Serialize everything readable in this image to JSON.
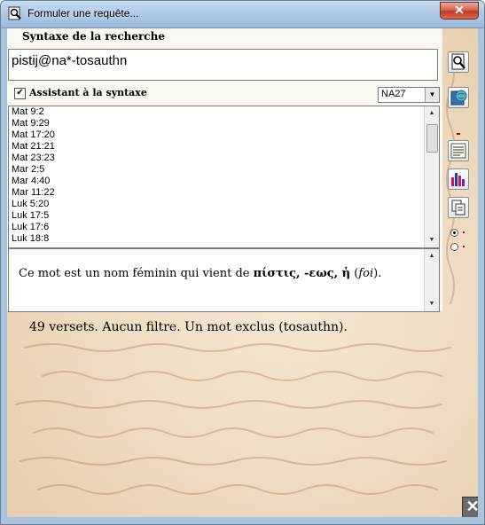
{
  "window": {
    "title": "Formuler une requête...",
    "close_glyph": "✕"
  },
  "panel": {
    "title": "Syntaxe de la recherche",
    "query_value": "pistij@na*-tosauthn",
    "assistant_label": "Assistant à la syntaxe",
    "assistant_checked_glyph": "✔",
    "version_select": "NA27",
    "verses": [
      "Mat 9:2",
      "Mat 9:29",
      "Mat 17:20",
      "Mat 21:21",
      "Mat 23:23",
      "Mar 2:5",
      "Mar 4:40",
      "Mar 11:22",
      "Luk 5:20",
      "Luk 17:5",
      "Luk 17:6",
      "Luk 18:8"
    ],
    "description": {
      "prefix": "Ce mot est un nom féminin qui vient de ",
      "greek": "πίστις, -εως, ἡ",
      "open_paren": " (",
      "meaning": "foi",
      "close_paren": ")."
    }
  },
  "status": {
    "text": "49 versets. Aucun filtre. Un mot exclus (tosauthn)."
  },
  "toolbar": {
    "icons": [
      "search-doc-icon",
      "bible-globe-icon",
      "notes-icon",
      "bar-chart-icon",
      "copy-icon"
    ]
  },
  "bottom_close_glyph": "✕",
  "colors": {
    "titlebar": "#aecae6",
    "close_red": "#c23b22",
    "parchment": "#efdcc2",
    "script_ink": "#b98a66",
    "accent_red": "#cc0000"
  }
}
